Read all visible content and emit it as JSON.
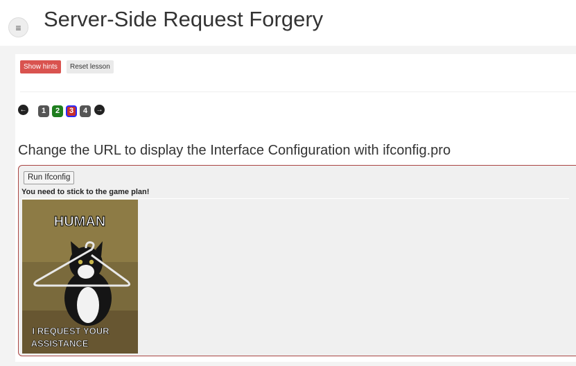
{
  "header": {
    "title": "Server-Side Request Forgery",
    "menu_icon": "≡"
  },
  "toolbar": {
    "show_hints": "Show hints",
    "reset_lesson": "Reset lesson",
    "hints_color": "#d9534f"
  },
  "pagination": {
    "prev_icon": "←",
    "next_icon": "→",
    "pages": [
      {
        "label": "1",
        "state": "visited",
        "color": "#555555"
      },
      {
        "label": "2",
        "state": "solved",
        "color": "#1e7e1e"
      },
      {
        "label": "3",
        "state": "current",
        "color": "#c9302c",
        "border": "#2a2aff"
      },
      {
        "label": "4",
        "state": "unvisited",
        "color": "#555555"
      }
    ]
  },
  "lesson": {
    "instruction": "Change the URL to display the Interface Configuration with ifconfig.pro",
    "run_button": "Run Ifconfig",
    "feedback": "You need to stick to the game plan!",
    "meme": {
      "top_text": "HUMAN",
      "bottom_line1": "I REQUEST YOUR",
      "bottom_line2": "ASSISTANCE"
    }
  }
}
